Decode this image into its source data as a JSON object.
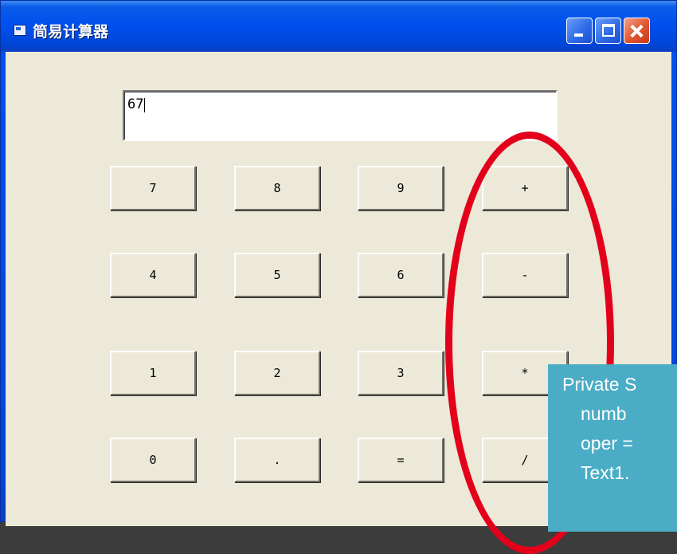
{
  "window": {
    "title": "简易计算器",
    "icon": "app-window-icon",
    "controls": [
      "minimize-icon",
      "maximize-icon",
      "close-icon"
    ]
  },
  "display": {
    "value": "67"
  },
  "keypad": {
    "rows": [
      [
        "7",
        "8",
        "9",
        "+"
      ],
      [
        "4",
        "5",
        "6",
        "-"
      ],
      [
        "1",
        "2",
        "3",
        "*"
      ],
      [
        "0",
        ".",
        "=",
        "/"
      ]
    ]
  },
  "annotation": {
    "highlight_color": "#e3001b",
    "code_lines": [
      "Private S",
      "numb",
      "oper =",
      "Text1."
    ]
  },
  "colors": {
    "titlebar": "#0050ee",
    "client_bg": "#ece9d8",
    "callout_bg": "#4bacc6"
  }
}
